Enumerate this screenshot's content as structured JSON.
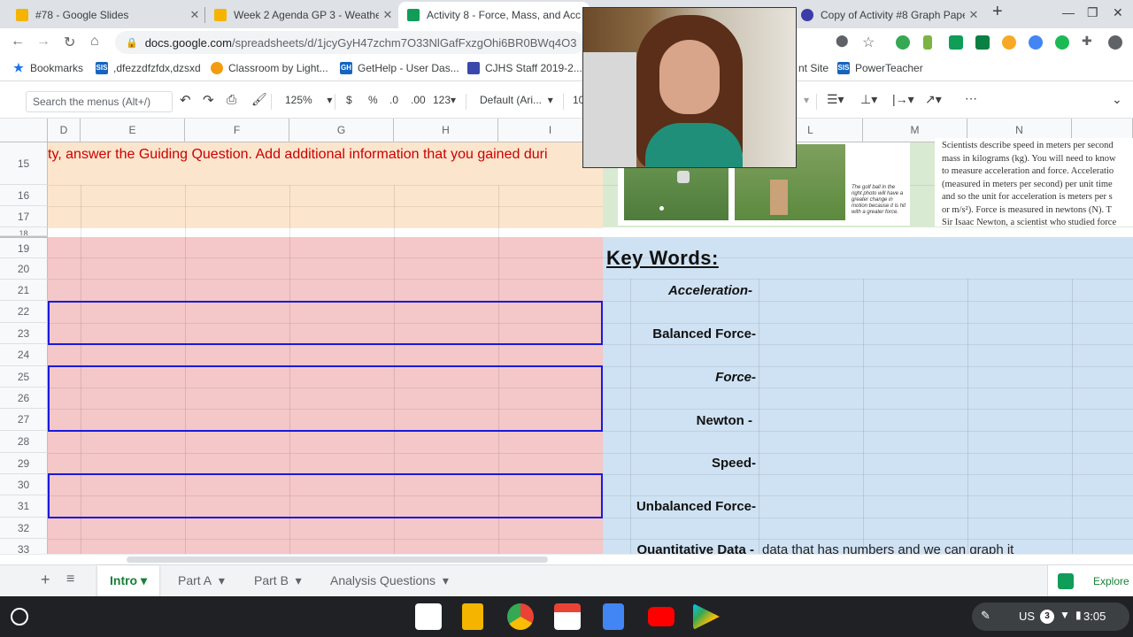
{
  "browser": {
    "tabs": [
      {
        "title": "#78 - Google Slides",
        "icon_color": "#f4b400",
        "active": false
      },
      {
        "title": "Week 2 Agenda GP 3 - Weather",
        "icon_color": "#f4b400",
        "active": false
      },
      {
        "title": "Activity 8 - Force, Mass, and Acc",
        "icon_color": "#0f9d58",
        "active": true
      },
      {
        "title": "Copy of Activity #8 Graph Pape",
        "icon_color": "#3c3ca8",
        "active": false
      }
    ],
    "new_tab_symbol": "+",
    "url_domain": "docs.google.com",
    "url_path": "/spreadsheets/d/1jcyGyH47zchm7O33NlGafFxzgOhi6BR0BWq4O3",
    "bookmarks": [
      {
        "label": "Bookmarks",
        "icon": "star-icon"
      },
      {
        "label": ",dfezzdfzfdx,dzsxd",
        "icon": "sis-icon"
      },
      {
        "label": "Classroom by Light...",
        "icon": "lightspeed-icon"
      },
      {
        "label": "GetHelp - User Das...",
        "icon": "gethelp-icon"
      },
      {
        "label": "CJHS Staff 2019-2...",
        "icon": "calendar-icon"
      },
      {
        "label": "nt Site",
        "icon": "site-icon"
      },
      {
        "label": "PowerTeacher",
        "icon": "sis-icon"
      }
    ]
  },
  "sheets_toolbar": {
    "search_placeholder": "Search the menus (Alt+/)",
    "zoom": "125%",
    "currency": "$",
    "percent": "%",
    "dec_decrease": ".0",
    "dec_increase": ".00",
    "more_formats": "123",
    "font": "Default (Ari...",
    "font_size": "10"
  },
  "grid": {
    "columns_left": [
      "D",
      "E",
      "F",
      "G",
      "H",
      "I"
    ],
    "columns_right": [
      "L",
      "M",
      "N"
    ],
    "rows": [
      "15",
      "16",
      "17",
      "18",
      "19",
      "20",
      "21",
      "22",
      "23",
      "24",
      "25",
      "26",
      "27",
      "28",
      "29",
      "30",
      "31",
      "32",
      "33"
    ],
    "row15_text": "ty, answer the Guiding Question. Add additional information that you gained duri",
    "key_words_title": "Key Words:",
    "key_words": [
      {
        "term": "Acceleration-",
        "italic": true
      },
      {
        "term": "Balanced Force-",
        "italic": false
      },
      {
        "term": "Force-",
        "italic": true
      },
      {
        "term": "Newton -",
        "italic": false
      },
      {
        "term": "Speed-",
        "italic": false
      },
      {
        "term": "Unbalanced Force-",
        "italic": false
      },
      {
        "term": "Quantitative Data -",
        "italic": false
      }
    ],
    "quantitative_definition": "data that has numbers and we can graph it",
    "image_caption": "The golf ball in the right photo will have a greater change in motion because it is hit with a greater force.",
    "article_lines": [
      "Scientists describe speed in meters per second",
      "mass in kilograms (kg). You will need to know",
      "to measure acceleration and force. Acceleratio",
      "(measured in meters per second) per unit time",
      "and so the unit for acceleration is meters per s",
      "or m/s²). Force is measured in newtons (N). T",
      "Sir Isaac Newton, a scientist who studied force"
    ]
  },
  "sheet_tabs": [
    {
      "label": "Intro",
      "active": true
    },
    {
      "label": "Part A",
      "active": false
    },
    {
      "label": "Part B",
      "active": false
    },
    {
      "label": "Analysis Questions",
      "active": false
    }
  ],
  "explore_label": "Explore",
  "shelf": {
    "locale": "US",
    "notification_count": "3",
    "time": "3:05"
  },
  "colors": {
    "peach": "#fce5cd",
    "pink": "#f4c7c8",
    "light_blue": "#cfe2f3",
    "green_cell": "#d9ead3",
    "red_text": "#cc0000",
    "box_border": "#1a1adc"
  }
}
